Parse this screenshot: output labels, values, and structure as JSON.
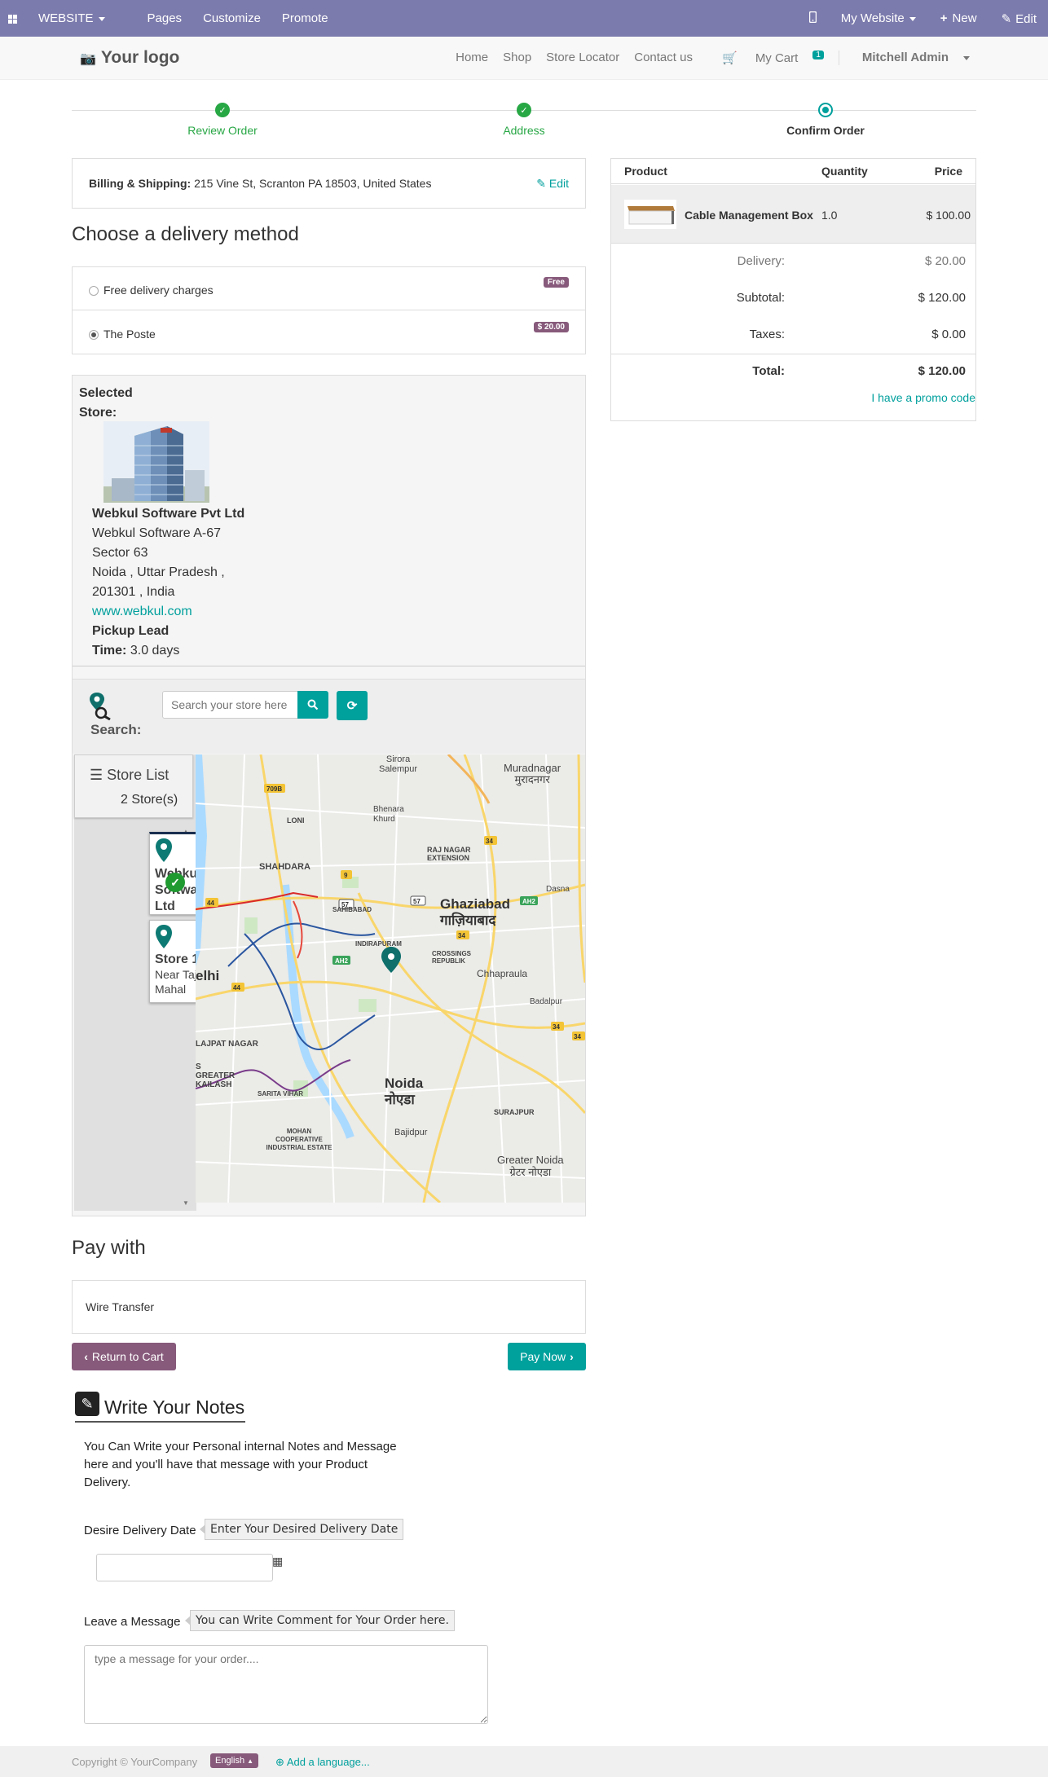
{
  "adminbar": {
    "website": "WEBSITE",
    "pages": "Pages",
    "customize": "Customize",
    "promote": "Promote",
    "my_website": "My Website",
    "new": "New",
    "edit": "Edit"
  },
  "header": {
    "logo": "Your logo",
    "nav": [
      "Home",
      "Shop",
      "Store Locator",
      "Contact us"
    ],
    "cart": "My Cart",
    "cart_count": "1",
    "user": "Mitchell Admin"
  },
  "wizard": {
    "steps": [
      {
        "label": "Review Order",
        "state": "done"
      },
      {
        "label": "Address",
        "state": "done"
      },
      {
        "label": "Confirm Order",
        "state": "current"
      }
    ]
  },
  "billing": {
    "label": "Billing & Shipping:",
    "address": "215 Vine St, Scranton PA 18503, United States",
    "edit": "Edit"
  },
  "delivery": {
    "title": "Choose a delivery method",
    "options": [
      {
        "name": "Free delivery charges",
        "price": "Free",
        "selected": false
      },
      {
        "name": "The Poste",
        "price": "$ 20.00",
        "selected": true
      }
    ]
  },
  "selected_store": {
    "title_line1": "Selected",
    "title_line2": "Store:",
    "name": "Webkul Software Pvt Ltd",
    "line1": "Webkul Software A-67",
    "line2": "Sector 63",
    "line3": "Noida , Uttar Pradesh ,",
    "line4": "201301 , India",
    "website": "www.webkul.com",
    "pickup_label1": "Pickup Lead",
    "pickup_label2": "Time:",
    "pickup_value": "3.0 days"
  },
  "store_search": {
    "label": "Search:",
    "placeholder": "Search your store here",
    "store_list_label": "Store List",
    "store_count": "2 Store(s)",
    "stores": [
      {
        "name": "Webkul Software Pvt Ltd",
        "sub": ""
      },
      {
        "name": "Store 1",
        "sub": "Near Taj Mahal"
      }
    ]
  },
  "map": {
    "labels": {
      "sirora": "Sirora",
      "salempur": "Salempur",
      "muradnagar": "Muradnagar",
      "muradnagar_hi": "मुरादनगर",
      "loni": "LONI",
      "bhenara": "Bhenara Khurd",
      "shahdara": "SHAHDARA",
      "raj_nagar": "RAJ NAGAR EXTENSION",
      "ghaziabad": "Ghaziabad",
      "ghaziabad_hi": "गाज़ियाबाद",
      "dasna": "Dasna",
      "sahibabad": "SAHIBABAD",
      "indirapuram": "INDIRAPURAM",
      "crossings": "CROSSINGS REPUBLIK",
      "chhapraula": "Chhapraula",
      "delhi": "elhi",
      "badalpur": "Badalpur",
      "lajpat": "LAJPAT NAGAR",
      "greater_kailash": "S GREATER KAILASH",
      "sarita_vihar": "SARITA VIHAR",
      "noida": "Noida",
      "noida_hi": "नोएडा",
      "surajpur": "SURAJPUR",
      "bajidpur": "Bajidpur",
      "mohan": "MOHAN COOPERATIVE INDUSTRIAL ESTATE",
      "greater_noida": "Greater Noida",
      "greater_noida_hi": "ग्रेटर नोएडा"
    }
  },
  "payment": {
    "title": "Pay with",
    "method": "Wire Transfer",
    "return_btn": "Return to Cart",
    "pay_btn": "Pay Now"
  },
  "notes": {
    "title": "Write Your Notes",
    "description": "You Can Write your Personal internal Notes and Message here and you'll have that message with your Product Delivery.",
    "date_label": "Desire Delivery Date",
    "date_tooltip": "Enter Your Desired Delivery Date",
    "message_label": "Leave a Message",
    "message_tooltip": "You can Write Comment for Your Order here.",
    "message_placeholder": "type a message for your order...."
  },
  "order_summary": {
    "col_product": "Product",
    "col_quantity": "Quantity",
    "col_price": "Price",
    "item_name": "Cable Management Box",
    "item_qty": "1.0",
    "item_price": "$ 100.00",
    "delivery_label": "Delivery:",
    "delivery_value": "$ 20.00",
    "subtotal_label": "Subtotal:",
    "subtotal_value": "$ 120.00",
    "taxes_label": "Taxes:",
    "taxes_value": "$ 0.00",
    "total_label": "Total:",
    "total_value": "$ 120.00",
    "promo": "I have a promo code"
  },
  "footer": {
    "copyright": "Copyright © YourCompany",
    "language": "English",
    "add_language": "Add a language..."
  },
  "colors": {
    "admin_bar": "#7c7bad",
    "primary": "#00a09d",
    "secondary": "#875a7b",
    "success": "#28a745"
  }
}
